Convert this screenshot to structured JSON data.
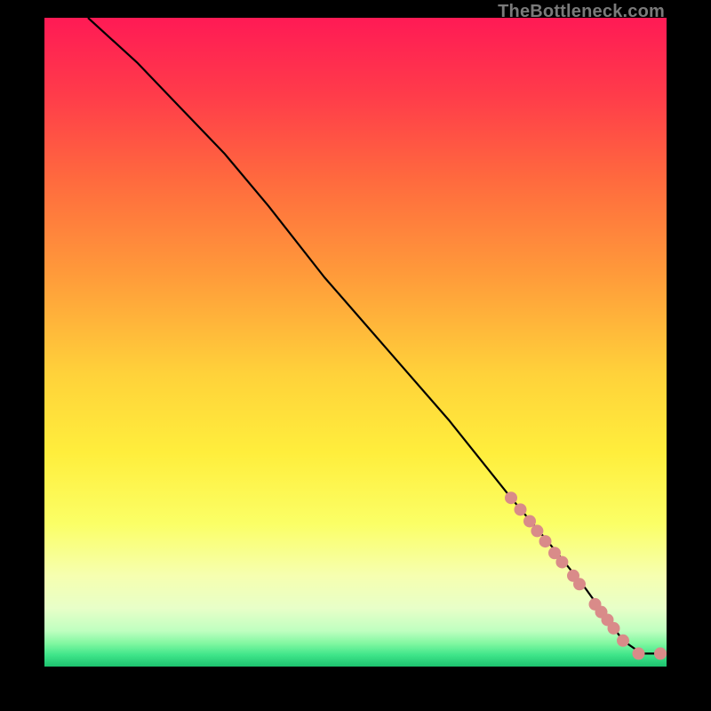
{
  "watermark": "TheBottleneck.com",
  "chart_data": {
    "type": "line",
    "title": "",
    "xlabel": "",
    "ylabel": "",
    "xlim": [
      0,
      100
    ],
    "ylim": [
      0,
      100
    ],
    "grid": false,
    "series": [
      {
        "name": "curve",
        "type": "line",
        "color": "#000000",
        "x": [
          7,
          15,
          22,
          29,
          36,
          45,
          55,
          65,
          75,
          82,
          87,
          90,
          93,
          96,
          99
        ],
        "y": [
          100,
          93,
          86,
          79,
          71,
          60,
          49,
          38,
          26,
          18,
          12,
          8,
          4,
          2,
          2
        ]
      },
      {
        "name": "points",
        "type": "scatter",
        "color": "#d98b89",
        "x": [
          75,
          76.5,
          78,
          79.2,
          80.5,
          82,
          83.2,
          85,
          86,
          88.5,
          89.5,
          90.5,
          91.5,
          93,
          95.5,
          99
        ],
        "y": [
          26,
          24.2,
          22.4,
          20.9,
          19.3,
          17.5,
          16.1,
          14,
          12.7,
          9.6,
          8.4,
          7.2,
          5.9,
          4,
          2,
          2
        ]
      }
    ],
    "background_gradient": {
      "direction": "vertical",
      "stops": [
        {
          "pos": 0.0,
          "color": "#ff1a55"
        },
        {
          "pos": 0.12,
          "color": "#ff3c4a"
        },
        {
          "pos": 0.25,
          "color": "#ff6a3e"
        },
        {
          "pos": 0.4,
          "color": "#ff9c3a"
        },
        {
          "pos": 0.55,
          "color": "#ffd23a"
        },
        {
          "pos": 0.67,
          "color": "#ffee3c"
        },
        {
          "pos": 0.78,
          "color": "#fbff66"
        },
        {
          "pos": 0.86,
          "color": "#f6ffb0"
        },
        {
          "pos": 0.91,
          "color": "#e8ffc8"
        },
        {
          "pos": 0.945,
          "color": "#bfffc0"
        },
        {
          "pos": 0.965,
          "color": "#7ff7a0"
        },
        {
          "pos": 0.982,
          "color": "#3fe58a"
        },
        {
          "pos": 1.0,
          "color": "#1cc26e"
        }
      ]
    }
  }
}
